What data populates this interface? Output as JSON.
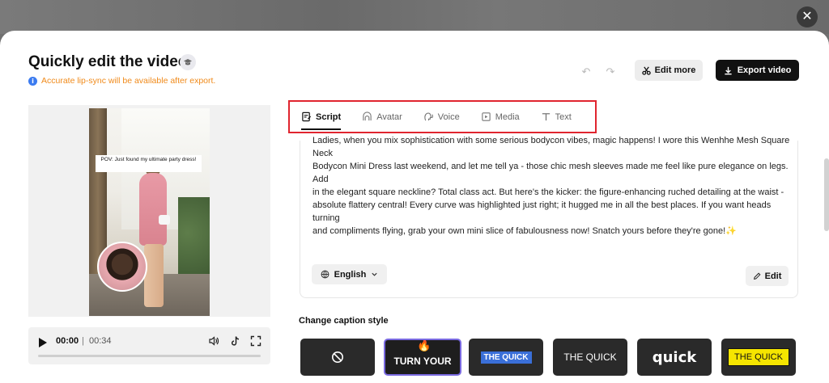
{
  "title": "Quickly edit the video",
  "notice": "Accurate lip-sync will be available after export.",
  "header": {
    "edit_more_label": "Edit more",
    "export_label": "Export video"
  },
  "video": {
    "caption_overlay": "POV: Just found my ultimate party dress!",
    "current_time": "00:00",
    "separator": "|",
    "duration": "00:34",
    "progress": 0
  },
  "tabs": [
    {
      "label": "Script",
      "icon": "script-icon",
      "active": true
    },
    {
      "label": "Avatar",
      "icon": "avatar-icon",
      "active": false
    },
    {
      "label": "Voice",
      "icon": "voice-icon",
      "active": false
    },
    {
      "label": "Media",
      "icon": "media-icon",
      "active": false
    },
    {
      "label": "Text",
      "icon": "text-icon",
      "active": false
    }
  ],
  "script": {
    "text_line1": "Ladies, when you mix sophistication with some serious bodycon vibes, magic happens! I wore this Wenhhe Mesh Square Neck",
    "text_line2": "Bodycon Mini Dress last weekend, and let me tell ya - those chic mesh sleeves made me feel like pure elegance on legs. Add",
    "text_line3": "in the elegant square neckline? Total class act. But here's the kicker: the figure-enhancing ruched detailing at the waist -",
    "text_line4": "absolute flattery central! Every curve was highlighted just right; it hugged me in all the best places. If you want heads turning",
    "text_line5": "and compliments flying, grab your own mini slice of fabulousness now! Snatch yours before they're gone!✨",
    "language": "English",
    "edit_label": "Edit"
  },
  "caption_style": {
    "title": "Change caption style",
    "options": [
      {
        "label": ""
      },
      {
        "label": "TURN YOUR",
        "selected": true
      },
      {
        "label": "THE QUICK"
      },
      {
        "label": "THE QUICK"
      },
      {
        "label": "quick"
      },
      {
        "label": "THE QUICK"
      }
    ]
  },
  "colors": {
    "accent_orange": "#f08a1a",
    "highlight_red": "#e0252f",
    "selected_purple": "#7a6ae0"
  }
}
